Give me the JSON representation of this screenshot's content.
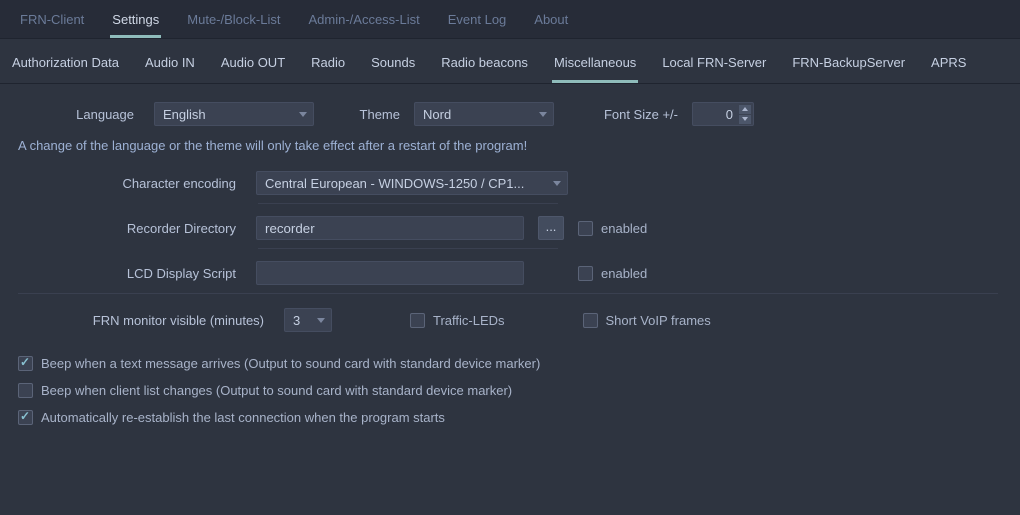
{
  "primary_tabs": {
    "frn_client": "FRN-Client",
    "settings": "Settings",
    "mute_block": "Mute-/Block-List",
    "admin_access": "Admin-/Access-List",
    "event_log": "Event Log",
    "about": "About"
  },
  "secondary_tabs": {
    "auth": "Authorization Data",
    "audio_in": "Audio IN",
    "audio_out": "Audio OUT",
    "radio": "Radio",
    "sounds": "Sounds",
    "beacons": "Radio beacons",
    "misc": "Miscellaneous",
    "local_server": "Local FRN-Server",
    "backup_server": "FRN-BackupServer",
    "aprs": "APRS"
  },
  "labels": {
    "language": "Language",
    "theme": "Theme",
    "font_size": "Font Size +/-",
    "restart_note": "A change of the language or the theme will only take effect after a restart of the program!",
    "char_enc": "Character encoding",
    "recorder_dir": "Recorder Directory",
    "lcd_script": "LCD Display Script",
    "enabled": "enabled",
    "frn_monitor": "FRN monitor visible (minutes)",
    "traffic_leds": "Traffic-LEDs",
    "short_voip": "Short VoIP frames",
    "beep_text": "Beep when a text message arrives (Output to sound card with standard device marker)",
    "beep_list": "Beep when client list changes (Output to sound card with standard device marker)",
    "auto_reconnect": "Automatically re-establish the last connection when the program starts",
    "browse": "..."
  },
  "values": {
    "language": "English",
    "theme": "Nord",
    "font_size": "0",
    "char_enc": "Central European - WINDOWS-1250 / CP1...",
    "recorder_dir": "recorder",
    "lcd_script": "",
    "frn_monitor": "3"
  }
}
